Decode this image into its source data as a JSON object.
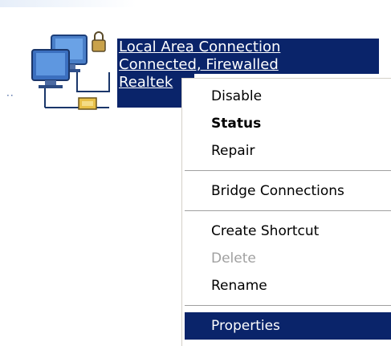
{
  "connection": {
    "name": "Local Area Connection",
    "status": "Connected, Firewalled",
    "adapter": "Realtek"
  },
  "stray_text": "⋅⋅",
  "context_menu": {
    "items": [
      {
        "label": "Disable",
        "bold": false,
        "disabled": false,
        "highlighted": false
      },
      {
        "label": "Status",
        "bold": true,
        "disabled": false,
        "highlighted": false
      },
      {
        "label": "Repair",
        "bold": false,
        "disabled": false,
        "highlighted": false
      },
      {
        "label": "Bridge Connections",
        "bold": false,
        "disabled": false,
        "highlighted": false
      },
      {
        "label": "Create Shortcut",
        "bold": false,
        "disabled": false,
        "highlighted": false
      },
      {
        "label": "Delete",
        "bold": false,
        "disabled": true,
        "highlighted": false
      },
      {
        "label": "Rename",
        "bold": false,
        "disabled": false,
        "highlighted": false
      },
      {
        "label": "Properties",
        "bold": false,
        "disabled": false,
        "highlighted": true
      }
    ]
  },
  "colors": {
    "selection": "#0a246a",
    "menu_bg": "#ffffff",
    "disabled_text": "#a0a0a0",
    "separator": "#a0a0a0"
  },
  "icons": {
    "connection_icon": "network-computers-icon",
    "lock_icon": "firewall-lock-icon"
  }
}
